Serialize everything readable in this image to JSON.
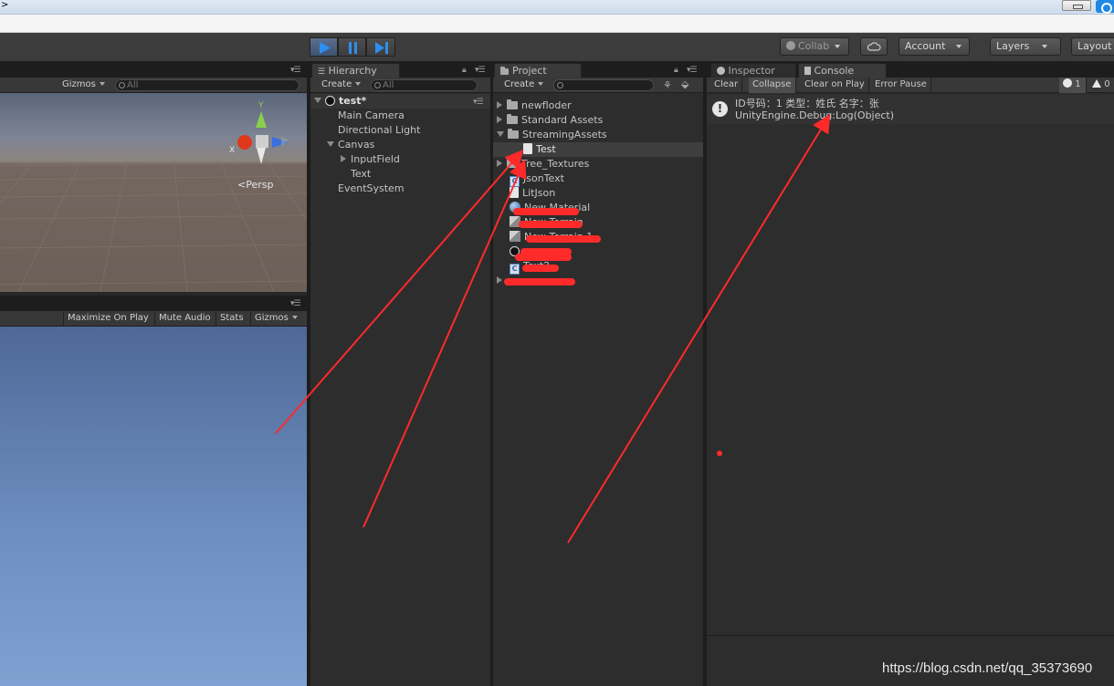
{
  "titlebar": {
    "glyph": ">"
  },
  "toolbar": {
    "collab": "Collab",
    "account": "Account",
    "layers": "Layers",
    "layout": "Layout"
  },
  "scene": {
    "gizmos": "Gizmos",
    "search_placeholder": "All",
    "persp": "Persp",
    "axis_y": "Y",
    "axis_x": "X"
  },
  "game": {
    "maximize": "Maximize On Play",
    "mute": "Mute Audio",
    "stats": "Stats",
    "gizmos": "Gizmos"
  },
  "hierarchy": {
    "tab": "Hierarchy",
    "create": "Create",
    "search_placeholder": "All",
    "scene_name": "test*",
    "items": [
      {
        "label": "Main Camera"
      },
      {
        "label": "Directional Light"
      },
      {
        "label": "Canvas"
      },
      {
        "label": "InputField"
      },
      {
        "label": "Text"
      },
      {
        "label": "EventSystem"
      }
    ]
  },
  "project": {
    "tab": "Project",
    "create": "Create",
    "items": [
      {
        "label": "newfloder"
      },
      {
        "label": "Standard Assets"
      },
      {
        "label": "StreamingAssets"
      },
      {
        "label": "Test"
      },
      {
        "label": "Tree_Textures"
      },
      {
        "label": "JsonText"
      },
      {
        "label": "LitJson"
      },
      {
        "label": "New Material"
      },
      {
        "label": "New Terrain"
      },
      {
        "label": "New Terrain 1"
      },
      {
        "label": ""
      },
      {
        "label": "Text2"
      },
      {
        "label": ""
      }
    ]
  },
  "inspector": {
    "tab": "Inspector"
  },
  "console": {
    "tab": "Console",
    "clear": "Clear",
    "collapse": "Collapse",
    "clear_on_play": "Clear on Play",
    "error_pause": "Error Pause",
    "info_count": "1",
    "warn_count": "0",
    "log_line1": "ID号码：1  类型：姓氏  名字：张",
    "log_line2": "UnityEngine.Debug:Log(Object)"
  },
  "watermark": "https://blog.csdn.net/qq_35373690",
  "colors": {
    "annotation": "#ff2a2a",
    "play_active": "#2c6ed6"
  }
}
